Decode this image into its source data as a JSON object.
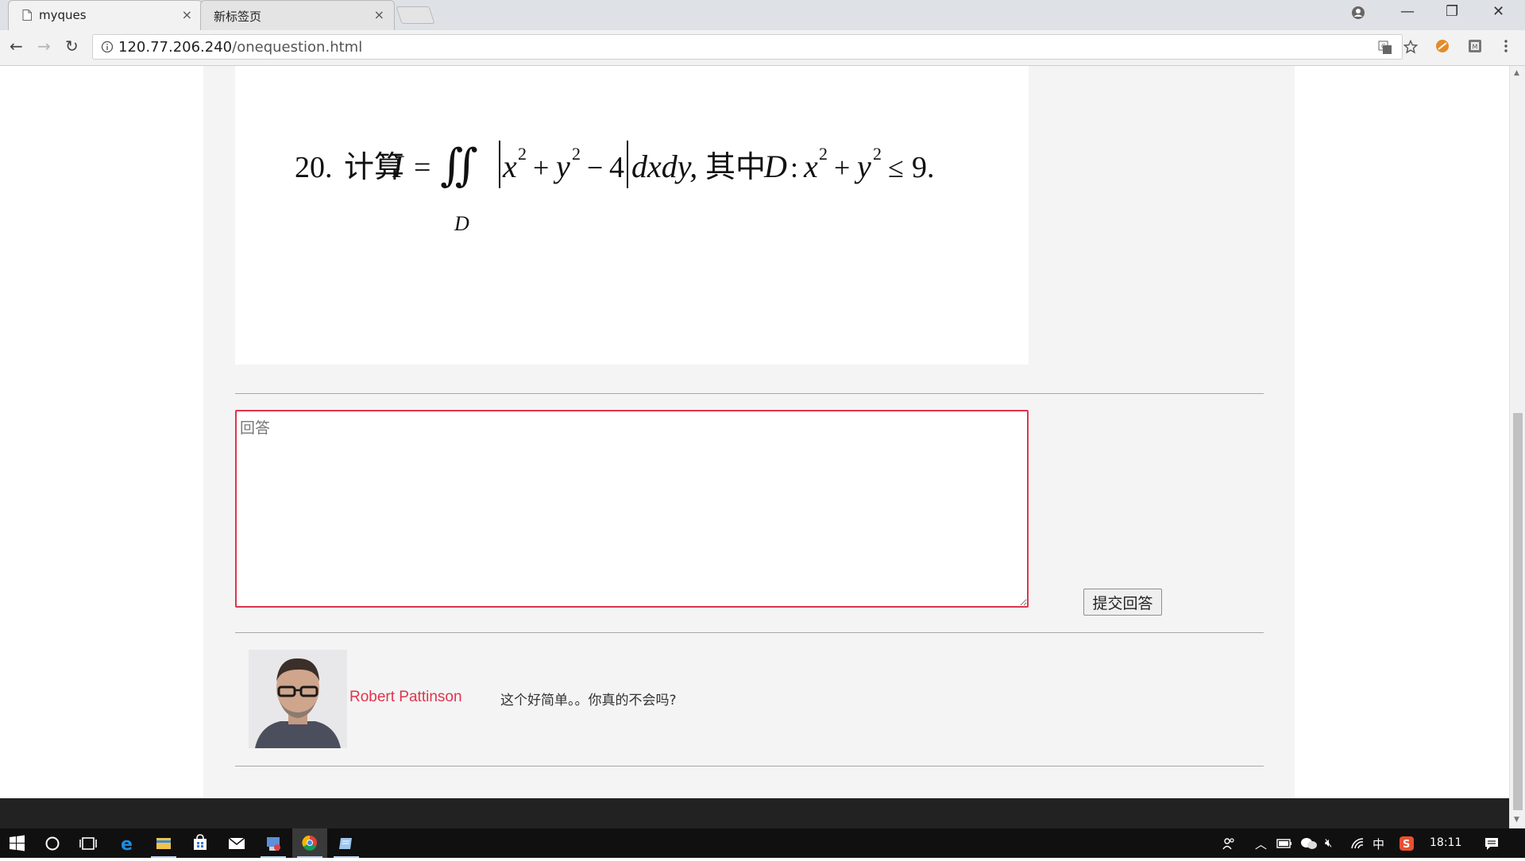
{
  "browser": {
    "tabs": [
      {
        "title": "myques",
        "active": true
      },
      {
        "title": "新标签页",
        "active": false
      }
    ],
    "tab_close_glyph": "×",
    "window_controls": {
      "minimize": "—",
      "restore": "❐",
      "close": "✕"
    },
    "url": {
      "host": "120.77.206.240",
      "path": "/onequestion.html"
    },
    "nav": {
      "back": "←",
      "forward": "→",
      "reload": "↻"
    },
    "omnibox_icons": [
      "translate-icon",
      "bookmark-star-icon"
    ],
    "extensions": [
      "extension-icon-1",
      "extension-icon-2",
      "menu-icon"
    ]
  },
  "question": {
    "number": "20.",
    "prefix": "计算",
    "formula_text": "I = ∬ |x² + y² − 4| dxdy, 其中 D: x² + y² ≤ 9.",
    "domain_label": "D",
    "where_label": "其中"
  },
  "answer": {
    "placeholder": "回答",
    "submit_label": "提交回答"
  },
  "comments": [
    {
      "author": "Robert Pattinson",
      "text": "这个好简单。。你真的不会吗?"
    }
  ],
  "colors": {
    "accent": "#e0344d",
    "page_column": "#f4f4f4",
    "footer": "#222222",
    "taskbar": "#101010"
  },
  "taskbar": {
    "apps": [
      "windows-start-icon",
      "cortana-search-icon",
      "task-view-icon",
      "edge-icon",
      "file-explorer-icon",
      "store-icon",
      "mail-icon",
      "app-icon",
      "chrome-icon",
      "notepad-icon"
    ],
    "tray": {
      "ime": "中",
      "time": "18:11"
    }
  }
}
